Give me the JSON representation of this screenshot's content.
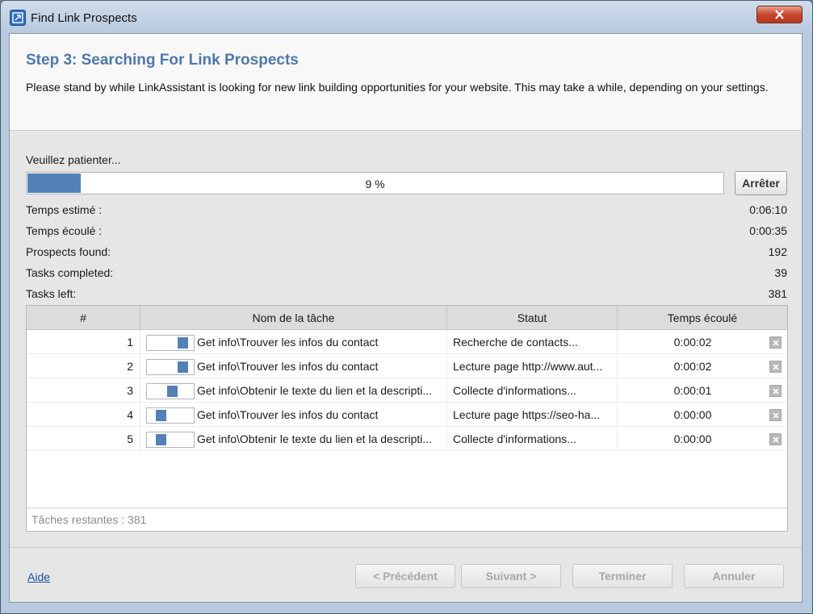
{
  "window": {
    "title": "Find Link Prospects",
    "icon": "link-assistant-app-icon"
  },
  "header": {
    "step_title": "Step 3: Searching For Link Prospects",
    "description": "Please stand by while LinkAssistant is looking for new link building opportunities for your website. This may take a while, depending on your settings."
  },
  "progress": {
    "label": "Veuillez patienter...",
    "percent_text": "9 %",
    "percent": 9,
    "stop_label": "Arrêter"
  },
  "stats": [
    {
      "label": "Temps estimé :",
      "value": "0:06:10"
    },
    {
      "label": "Temps écoulé :",
      "value": "0:00:35"
    },
    {
      "label": "Prospects found:",
      "value": "192"
    },
    {
      "label": "Tasks completed:",
      "value": "39"
    },
    {
      "label": "Tasks left:",
      "value": "381"
    }
  ],
  "table": {
    "columns": [
      "#",
      "Nom de la tâche",
      "Statut",
      "Temps écoulé"
    ],
    "rows": [
      {
        "num": "1",
        "task": "Get info\\Trouver les infos du contact",
        "status": "Recherche de contacts...",
        "time": "0:00:02",
        "activity": 0.85
      },
      {
        "num": "2",
        "task": "Get info\\Trouver les infos du contact",
        "status": "Lecture page http://www.aut...",
        "time": "0:00:02",
        "activity": 0.85
      },
      {
        "num": "3",
        "task": "Get info\\Obtenir le texte du lien et la descripti...",
        "status": "Collecte d'informations...",
        "time": "0:00:01",
        "activity": 0.55
      },
      {
        "num": "4",
        "task": "Get info\\Trouver les infos du contact",
        "status": "Lecture page https://seo-ha...",
        "time": "0:00:00",
        "activity": 0.25
      },
      {
        "num": "5",
        "task": "Get info\\Obtenir le texte du lien et la descripti...",
        "status": "Collecte d'informations...",
        "time": "0:00:00",
        "activity": 0.25
      }
    ],
    "footer": "Tâches restantes : 381"
  },
  "footer": {
    "help": "Aide",
    "prev": "< Précédent",
    "next": "Suivant >",
    "finish": "Terminer",
    "cancel": "Annuler"
  },
  "colors": {
    "accent": "#4e78a9",
    "progress_fill": "#5480b8"
  }
}
